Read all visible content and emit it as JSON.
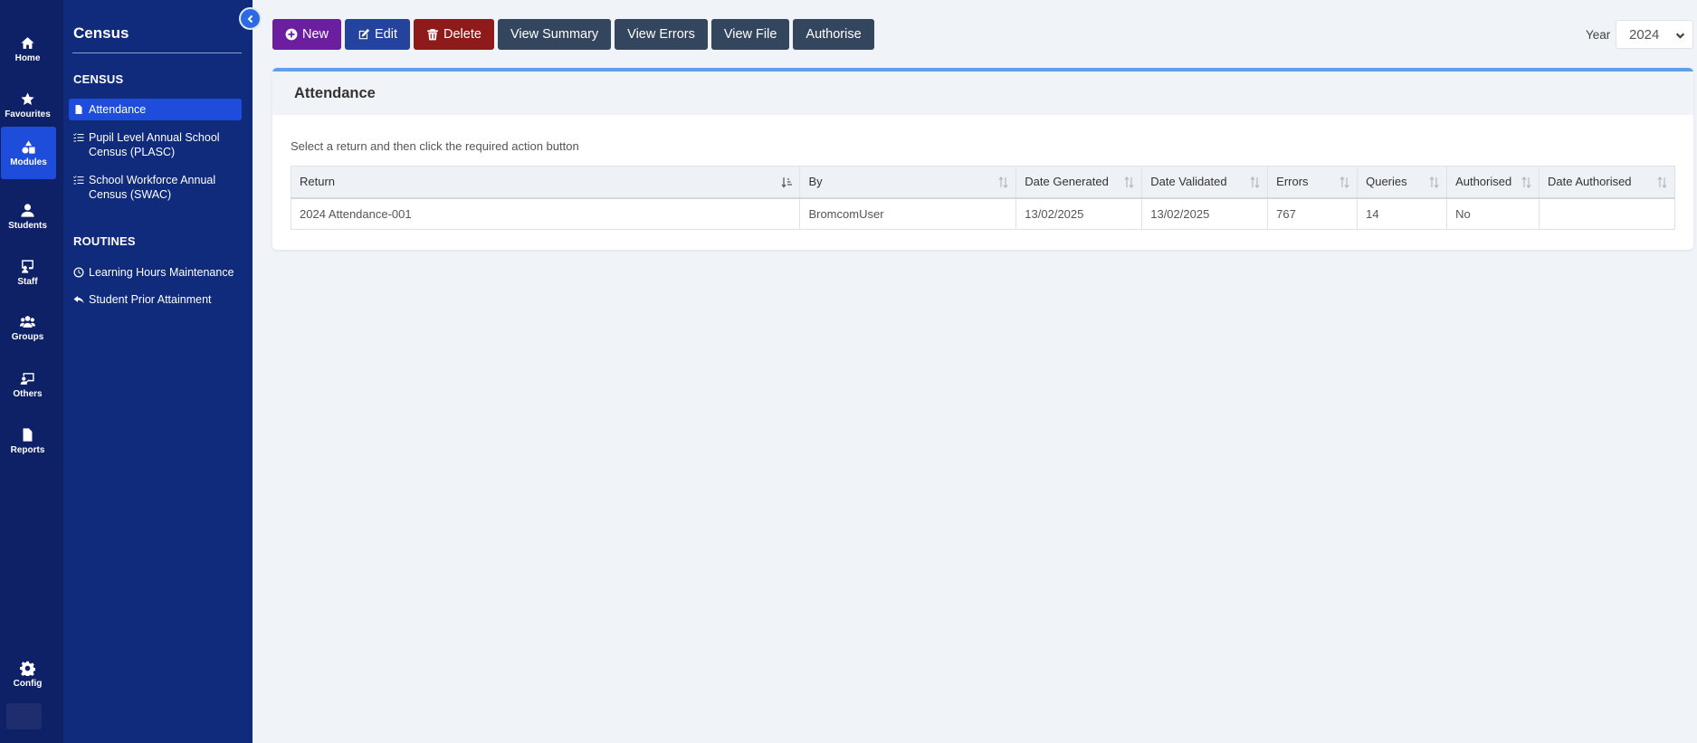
{
  "rail": {
    "items": [
      {
        "label": "Home",
        "icon": "home-icon"
      },
      {
        "label": "Favourites",
        "icon": "star-icon"
      },
      {
        "label": "Modules",
        "icon": "shapes-icon"
      },
      {
        "label": "Students",
        "icon": "user-icon"
      },
      {
        "label": "Staff",
        "icon": "chalkboard-user-icon"
      },
      {
        "label": "Groups",
        "icon": "users-icon"
      },
      {
        "label": "Others",
        "icon": "chalkboard-icon"
      },
      {
        "label": "Reports",
        "icon": "file-icon"
      },
      {
        "label": "Config",
        "icon": "gear-icon"
      }
    ],
    "active": "Modules"
  },
  "sidebar": {
    "title": "Census",
    "census_heading": "CENSUS",
    "census_items": [
      {
        "label": "Attendance",
        "icon": "file-icon"
      },
      {
        "label": "Pupil Level Annual School Census (PLASC)",
        "icon": "list-check-icon"
      },
      {
        "label": "School Workforce Annual Census (SWAC)",
        "icon": "list-check-icon"
      }
    ],
    "routines_heading": "ROUTINES",
    "routine_items": [
      {
        "label": "Learning Hours Maintenance",
        "icon": "clock-icon"
      },
      {
        "label": "Student Prior Attainment",
        "icon": "reply-icon"
      }
    ]
  },
  "toolbar": {
    "new": "New",
    "edit": "Edit",
    "delete": "Delete",
    "view_summary": "View Summary",
    "view_errors": "View Errors",
    "view_file": "View File",
    "authorise": "Authorise"
  },
  "year": {
    "label": "Year",
    "value": "2024"
  },
  "panel": {
    "title": "Attendance",
    "hint": "Select a return and then click the required action button"
  },
  "table": {
    "headers": [
      "Return",
      "By",
      "Date Generated",
      "Date Validated",
      "Errors",
      "Queries",
      "Authorised",
      "Date Authorised"
    ],
    "rows": [
      [
        "2024 Attendance-001",
        "BromcomUser",
        "13/02/2025",
        "13/02/2025",
        "767",
        "14",
        "No",
        ""
      ]
    ]
  },
  "colors": {
    "rail_bg": "#0f2166",
    "sidebar_bg": "#102a7c",
    "active_blue": "#1f4ddb",
    "new_purple": "#6b1f9e",
    "edit_blue": "#24439e",
    "delete_red": "#8e1a1a",
    "action_slate": "#33465e",
    "panel_accent": "#5ea0ea"
  }
}
